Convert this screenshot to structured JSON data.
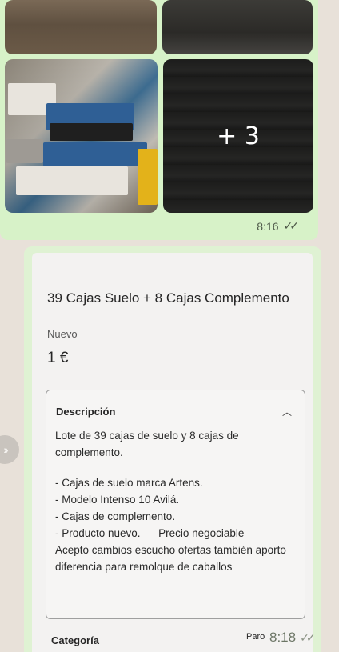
{
  "photo_message": {
    "more_photos": "+ 3",
    "time": "8:16",
    "read_status_icon": "double-check-icon"
  },
  "listing": {
    "title": "39 Cajas Suelo + 8 Cajas Complemento",
    "condition": "Nuevo",
    "price": "1 €",
    "description": {
      "heading": "Descripción",
      "toggle_icon": "chevron-up-icon",
      "intro": "Lote de 39 cajas de suelo y 8 cajas de complemento.",
      "points": [
        "- Cajas de suelo marca Artens.",
        "- Modelo Intenso 10 Avilá.",
        "- Cajas de complemento.",
        "- Producto nuevo.      Precio negociable"
      ],
      "closing": "Acepto cambios escucho ofertas también aporto diferencia para remolque de caballos"
    },
    "category": {
      "label": "Categoría",
      "value": "Paro"
    }
  },
  "listing_message": {
    "time": "8:18",
    "read_status_icon": "double-check-icon"
  },
  "colors": {
    "chat_background": "#e8e1d9",
    "outgoing_bubble": "#d7f2c8",
    "card_background": "#f3f2f1"
  }
}
